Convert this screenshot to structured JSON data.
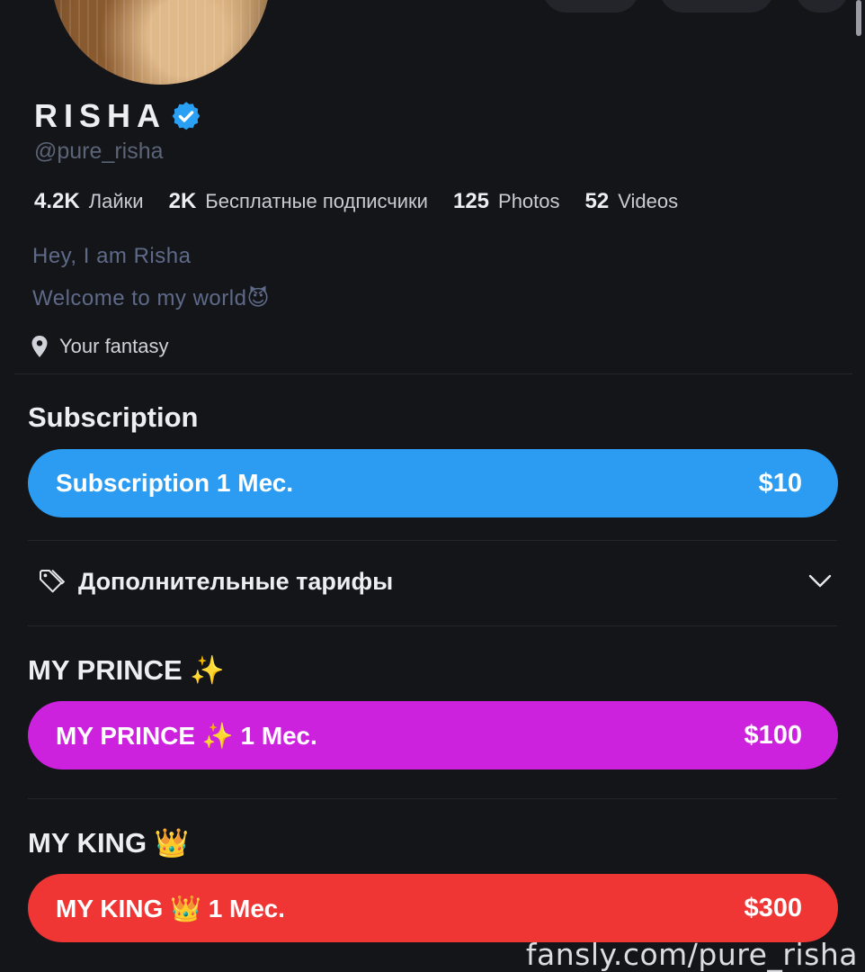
{
  "profile": {
    "name": "RISHA",
    "handle": "@pure_risha",
    "stats": [
      {
        "value": "4.2K",
        "label": "Лайки"
      },
      {
        "value": "2K",
        "label": "Бесплатные подписчики"
      },
      {
        "value": "125",
        "label": "Photos"
      },
      {
        "value": "52",
        "label": "Videos"
      }
    ],
    "bio_line1": "Hey, I am Risha",
    "bio_line2": "Welcome to my world😈",
    "location": "Your fantasy"
  },
  "subscription": {
    "title": "Subscription",
    "plan_label": "Subscription 1 Мес.",
    "plan_price": "$10",
    "plan_color": "#2b9cf2"
  },
  "extra_tariffs": {
    "label": "Дополнительные тарифы"
  },
  "tiers": [
    {
      "title": "MY PRINCE ✨",
      "plan_label": "MY PRINCE ✨ 1 Мес.",
      "price": "$100",
      "color": "#cc22de"
    },
    {
      "title": "MY KING 👑",
      "plan_label": "MY KING 👑 1 Мес.",
      "price": "$300",
      "color": "#f03535"
    }
  ],
  "watermark": "fansly.com/pure_risha",
  "icons": [
    "verified-badge-icon",
    "location-pin-icon",
    "tag-icon",
    "chevron-down-icon"
  ],
  "colors": {
    "background": "#141519",
    "accent_blue": "#2b9cf2",
    "verified": "#2aa0f5"
  }
}
